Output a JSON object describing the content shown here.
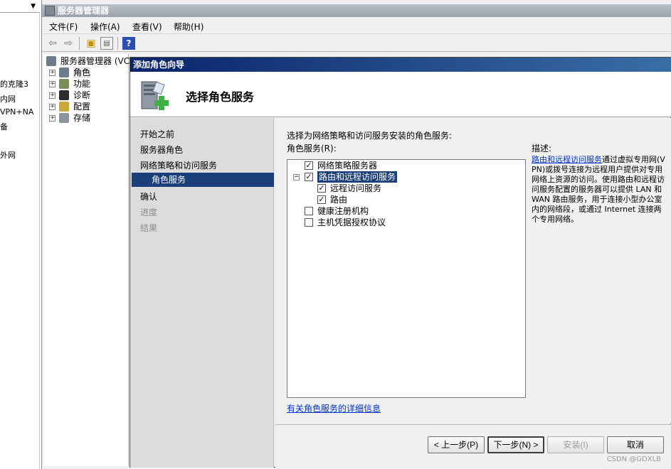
{
  "left_panel": {
    "items": [
      "的克隆3",
      "内网",
      "VPN+NA",
      "备",
      "外网"
    ]
  },
  "server_manager": {
    "title": "服务器管理器",
    "menu": [
      "文件(F)",
      "操作(A)",
      "查看(V)",
      "帮助(H)"
    ],
    "toolbar": [
      "back-icon",
      "forward-icon",
      "up-folder-icon",
      "show-hide-tree-icon",
      "help-icon"
    ],
    "tree": {
      "root": "服务器管理器 (VC",
      "items": [
        "角色",
        "功能",
        "诊断",
        "配置",
        "存储"
      ]
    }
  },
  "wizard": {
    "title": "添加角色向导",
    "header_title": "选择角色服务",
    "steps": [
      {
        "label": "开始之前",
        "state": "normal"
      },
      {
        "label": "服务器角色",
        "state": "normal"
      },
      {
        "label": "网络策略和访问服务",
        "state": "normal"
      },
      {
        "label": "角色服务",
        "state": "current"
      },
      {
        "label": "确认",
        "state": "normal"
      },
      {
        "label": "进度",
        "state": "disabled"
      },
      {
        "label": "结果",
        "state": "disabled"
      }
    ],
    "instruction": "选择为网络策略和访问服务安装的角色服务:",
    "list_label": "角色服务(R):",
    "services": [
      {
        "label": "网络策略服务器",
        "checked": true,
        "level": 0,
        "expander": false,
        "selected": false
      },
      {
        "label": "路由和远程访问服务",
        "checked": true,
        "level": 0,
        "expander": true,
        "selected": true
      },
      {
        "label": "远程访问服务",
        "checked": true,
        "level": 1,
        "expander": false,
        "selected": false
      },
      {
        "label": "路由",
        "checked": true,
        "level": 1,
        "expander": false,
        "selected": false
      },
      {
        "label": "健康注册机构",
        "checked": false,
        "level": 0,
        "expander": false,
        "selected": false
      },
      {
        "label": "主机凭据授权协议",
        "checked": false,
        "level": 0,
        "expander": false,
        "selected": false
      }
    ],
    "description_title": "描述:",
    "description_link": "路由和远程访问服务",
    "description_text": "通过虚拟专用网(VPN)或拨号连接为远程用户提供对专用网络上资源的访问。使用路由和远程访问服务配置的服务器可以提供 LAN 和 WAN 路由服务，用于连接小型办公室内的网络段，或通过 Internet 连接两个专用网络。",
    "more_info_link": "有关角色服务的详细信息",
    "buttons": {
      "back": "< 上一步(P)",
      "next": "下一步(N) >",
      "install": "安装(I)",
      "cancel": "取消"
    }
  },
  "watermark": "CSDN @GDXLB",
  "colors": {
    "wizard_title_start": "#0a246a",
    "wizard_title_end": "#3a6ea5",
    "selection": "#1b3f7a",
    "link": "#0033cc"
  }
}
